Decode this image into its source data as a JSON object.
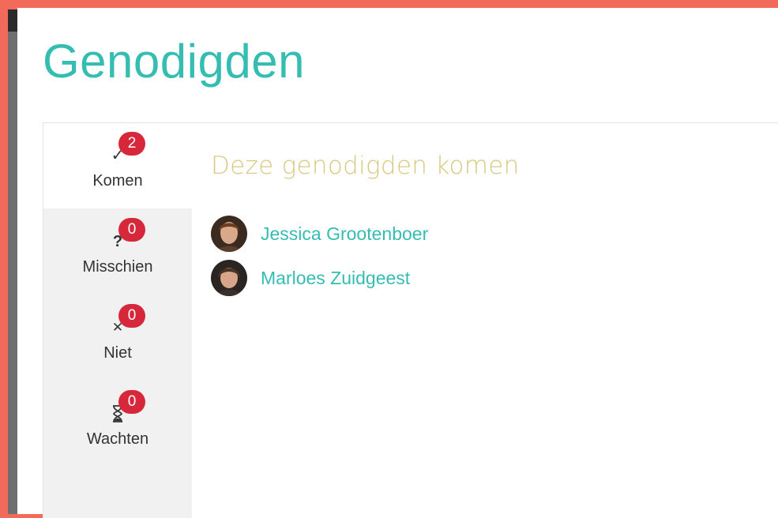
{
  "page": {
    "title": "Genodigden"
  },
  "tabs": [
    {
      "label": "Komen",
      "count": "2",
      "icon": "check-icon",
      "active": true
    },
    {
      "label": "Misschien",
      "count": "0",
      "icon": "question-icon",
      "active": false
    },
    {
      "label": "Niet",
      "count": "0",
      "icon": "x-icon",
      "active": false
    },
    {
      "label": "Wachten",
      "count": "0",
      "icon": "hourglass-icon",
      "active": false
    }
  ],
  "section": {
    "title": "Deze genodigden komen"
  },
  "guests": [
    {
      "name": "Jessica Grootenboer"
    },
    {
      "name": "Marloes Zuidgeest"
    }
  ],
  "colors": {
    "accent": "#35bdb2",
    "badge": "#d6283a",
    "section_title": "#d8c97f",
    "background": "#f26a5a"
  }
}
